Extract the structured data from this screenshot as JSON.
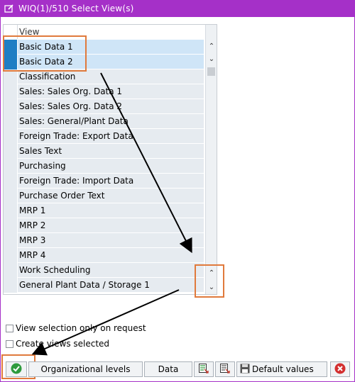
{
  "window": {
    "title": "WIQ(1)/510 Select View(s)",
    "title_bar_color": "#a530c8"
  },
  "table": {
    "header": "View",
    "rows": [
      {
        "label": "Basic Data 1",
        "selected": true
      },
      {
        "label": "Basic Data 2",
        "selected": true
      },
      {
        "label": "Classification",
        "selected": false
      },
      {
        "label": "Sales: Sales Org. Data 1",
        "selected": false
      },
      {
        "label": "Sales: Sales Org. Data 2",
        "selected": false
      },
      {
        "label": "Sales: General/Plant Data",
        "selected": false
      },
      {
        "label": "Foreign Trade: Export Data",
        "selected": false
      },
      {
        "label": "Sales Text",
        "selected": false
      },
      {
        "label": "Purchasing",
        "selected": false
      },
      {
        "label": "Foreign Trade: Import Data",
        "selected": false
      },
      {
        "label": "Purchase Order Text",
        "selected": false
      },
      {
        "label": "MRP 1",
        "selected": false
      },
      {
        "label": "MRP 2",
        "selected": false
      },
      {
        "label": "MRP 3",
        "selected": false
      },
      {
        "label": "MRP 4",
        "selected": false
      },
      {
        "label": "Work Scheduling",
        "selected": false
      },
      {
        "label": "General Plant Data / Storage 1",
        "selected": false
      }
    ],
    "selection_color": "#1f7ec4"
  },
  "options": {
    "view_selection_label": "View selection only on request",
    "create_views_label": "Create views selected"
  },
  "buttons": {
    "confirm_icon": "checkmark-icon",
    "org_levels_label": "Organizational levels",
    "data_label": "Data",
    "select_all_icon": "select-all-icon",
    "deselect_all_icon": "deselect-all-icon",
    "default_values_label": "Default values",
    "cancel_icon": "cancel-icon"
  },
  "annotation_color": "#e07a3c"
}
